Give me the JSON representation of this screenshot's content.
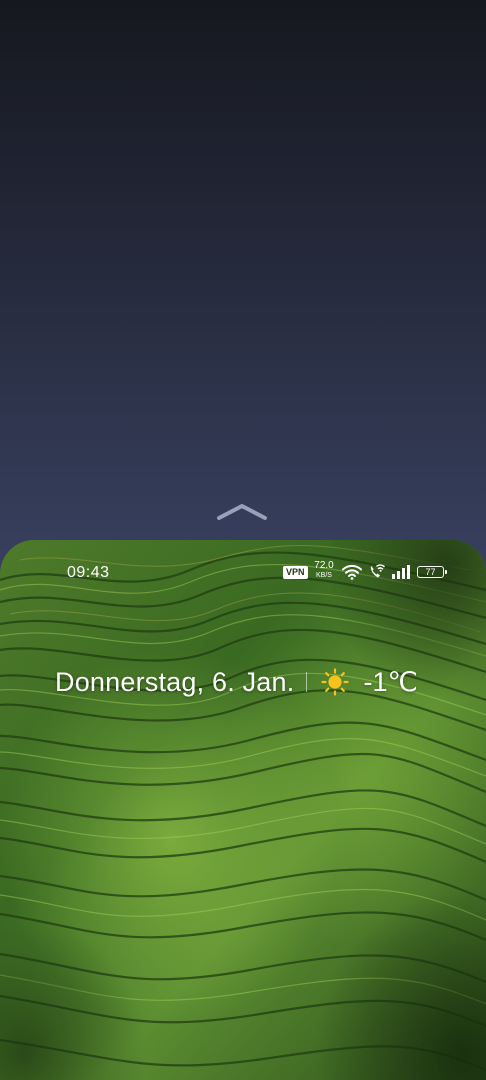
{
  "status_bar": {
    "time": "09:43",
    "vpn_label": "VPN",
    "net_speed_value": "72.0",
    "net_speed_unit": "KB/S",
    "battery_level": "77",
    "icons": [
      "wifi-icon",
      "wifi-calling-icon",
      "cell-signal-icon",
      "battery-icon"
    ]
  },
  "lock_widget": {
    "date": "Donnerstag, 6. Jan.",
    "weather_icon": "sun-icon",
    "temperature": "-1℃"
  },
  "colors": {
    "sun": "#f7c21b",
    "text": "#ffffff",
    "terrace_dark": "#1d3a12",
    "terrace_light": "#8fc24a"
  }
}
